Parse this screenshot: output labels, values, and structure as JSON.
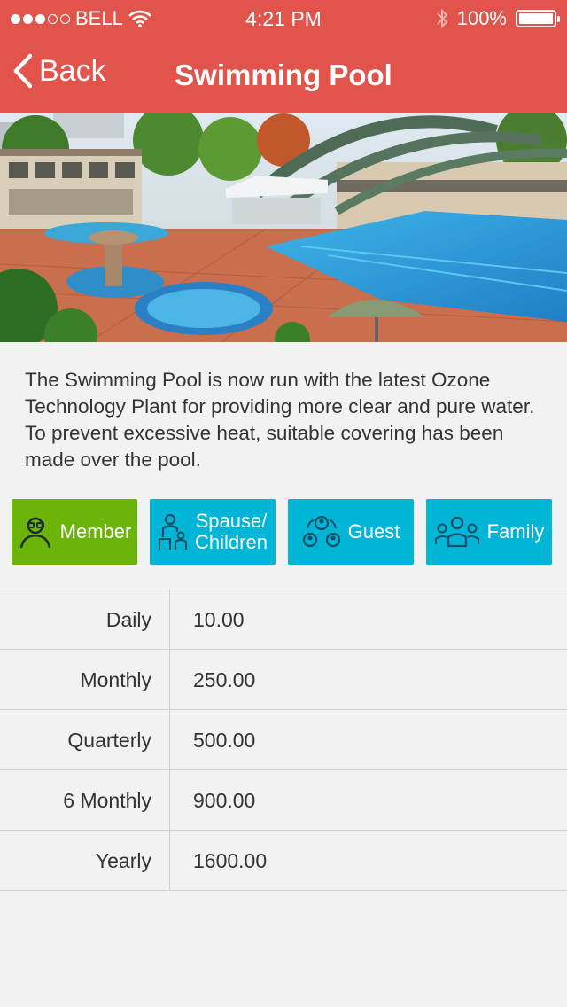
{
  "status": {
    "carrier": "BELL",
    "time": "4:21 PM",
    "battery": "100%",
    "signal_bars_filled": 3,
    "signal_bars_total": 5
  },
  "nav": {
    "back_label": "Back",
    "title": "Swimming Pool"
  },
  "description": "The Swimming Pool is now run with the latest Ozone Technology Plant for providing more clear and pure water. To prevent excessive heat, suitable covering has been made over the pool.",
  "categories": [
    {
      "label": "Member",
      "icon": "member-icon",
      "active": true
    },
    {
      "label_line1": "Spause/",
      "label_line2": "Children",
      "icon": "spouse-children-icon",
      "active": false
    },
    {
      "label": "Guest",
      "icon": "guest-icon",
      "active": false
    },
    {
      "label": "Family",
      "icon": "family-icon",
      "active": false
    }
  ],
  "rates": [
    {
      "period": "Daily",
      "price": "10.00"
    },
    {
      "period": "Monthly",
      "price": "250.00"
    },
    {
      "period": "Quarterly",
      "price": "500.00"
    },
    {
      "period": "6 Monthly",
      "price": "900.00"
    },
    {
      "period": "Yearly",
      "price": "1600.00"
    }
  ],
  "colors": {
    "header": "#e0544c",
    "active_tab": "#6cb30a",
    "tab": "#00b5d6",
    "background": "#f2f2f2"
  }
}
